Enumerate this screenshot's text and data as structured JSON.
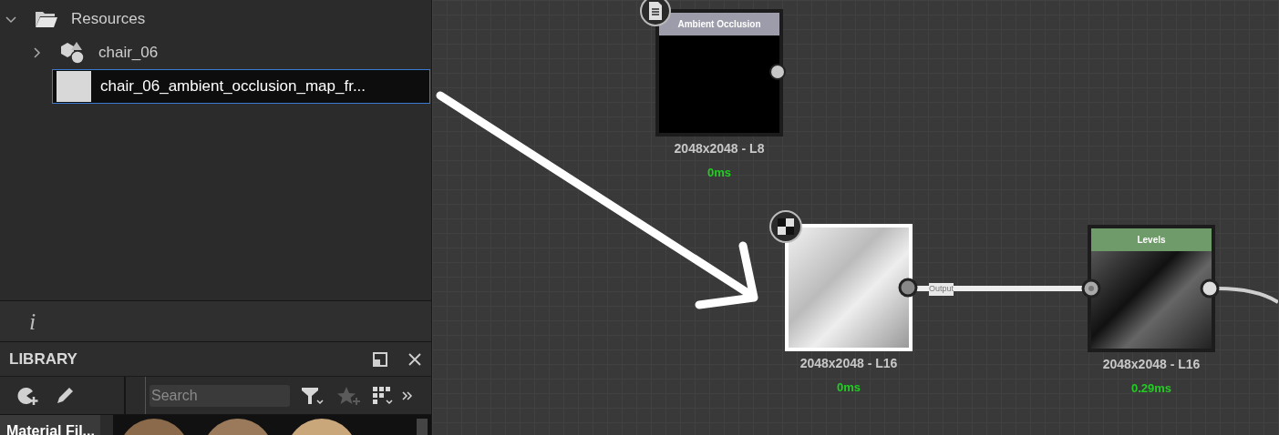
{
  "explorer": {
    "items": [
      {
        "kind": "folder",
        "label": "Resources",
        "expanded": true,
        "selected": false
      },
      {
        "kind": "graph",
        "label": "chair_06",
        "expanded": false,
        "selected": false
      },
      {
        "kind": "bitmap",
        "label": "chair_06_ambient_occlusion_map_fr...",
        "selected": true
      }
    ]
  },
  "info_bar": {
    "icon_text": "i"
  },
  "library": {
    "title": "LIBRARY",
    "search": {
      "placeholder": "Search"
    },
    "category": "Material Fil..."
  },
  "graph": {
    "nodes": [
      {
        "kind": "bitmap-input",
        "title": "Ambient Occlusion",
        "resolution": "2048x2048 - L8",
        "time": "0ms",
        "selected": false
      },
      {
        "kind": "image-input",
        "resolution": "2048x2048 - L16",
        "time": "0ms",
        "selected": true
      },
      {
        "kind": "levels",
        "title": "Levels",
        "resolution": "2048x2048 - L16",
        "time": "0.29ms",
        "selected": false
      }
    ],
    "connection_label": "Output"
  }
}
